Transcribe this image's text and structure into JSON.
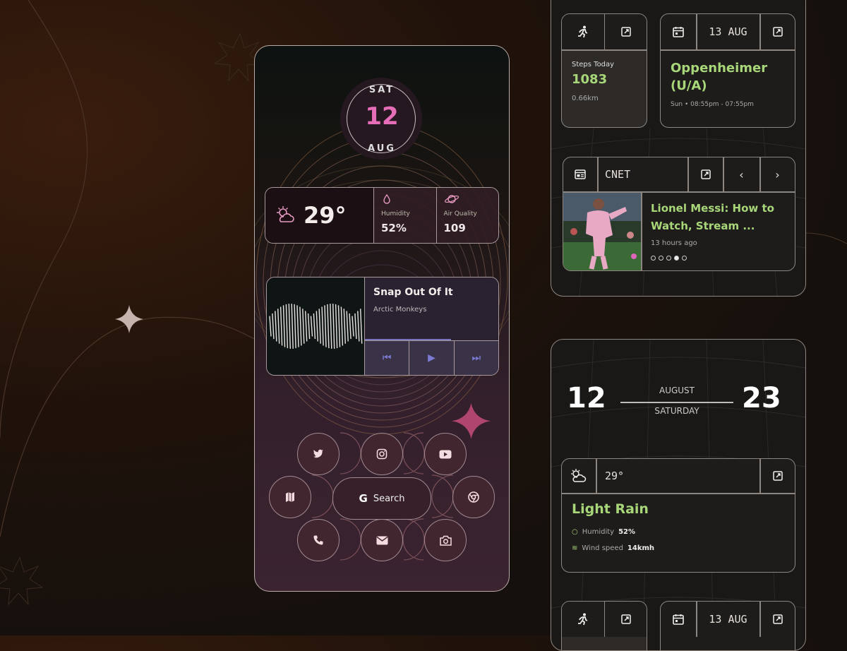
{
  "phone": {
    "date": {
      "dow": "SAT",
      "day": "12",
      "month": "AUG"
    },
    "weather": {
      "temp": "29°",
      "humidity_label": "Humidity",
      "humidity": "52%",
      "air_label": "Air Quality",
      "air": "109"
    },
    "music": {
      "title": "Snap Out Of It",
      "artist": "Arctic Monkeys",
      "progress": 0.65
    },
    "search_label": "Search",
    "apps": [
      "twitter-icon",
      "instagram-icon",
      "youtube-icon",
      "maps-icon",
      "chrome-icon",
      "phone-icon",
      "mail-icon",
      "camera-icon"
    ]
  },
  "steps": {
    "label": "Steps Today",
    "value": "1083",
    "distance": "0.66km"
  },
  "event": {
    "date": "13 AUG",
    "title": "Oppenheimer (U/A)",
    "time": "Sun • 08:55pm - 07:55pm"
  },
  "news": {
    "source": "CNET",
    "headline": "Lionel Messi: How to Watch, Stream ...",
    "age": "13 hours ago",
    "page": 4,
    "pages": 5
  },
  "date_widget": {
    "day": "12",
    "month": "AUGUST",
    "weekday": "SATURDAY",
    "year": "23"
  },
  "weather2": {
    "temp": "29°",
    "condition": "Light Rain",
    "humidity_label": "Humidity",
    "humidity": "52%",
    "wind_label": "Wind speed",
    "wind": "14kmh"
  },
  "bottom": {
    "date": "13 AUG"
  },
  "colors": {
    "accent_pink": "#e66db8",
    "accent_green": "#a8d77a",
    "player_blue": "#7b7ad2"
  }
}
